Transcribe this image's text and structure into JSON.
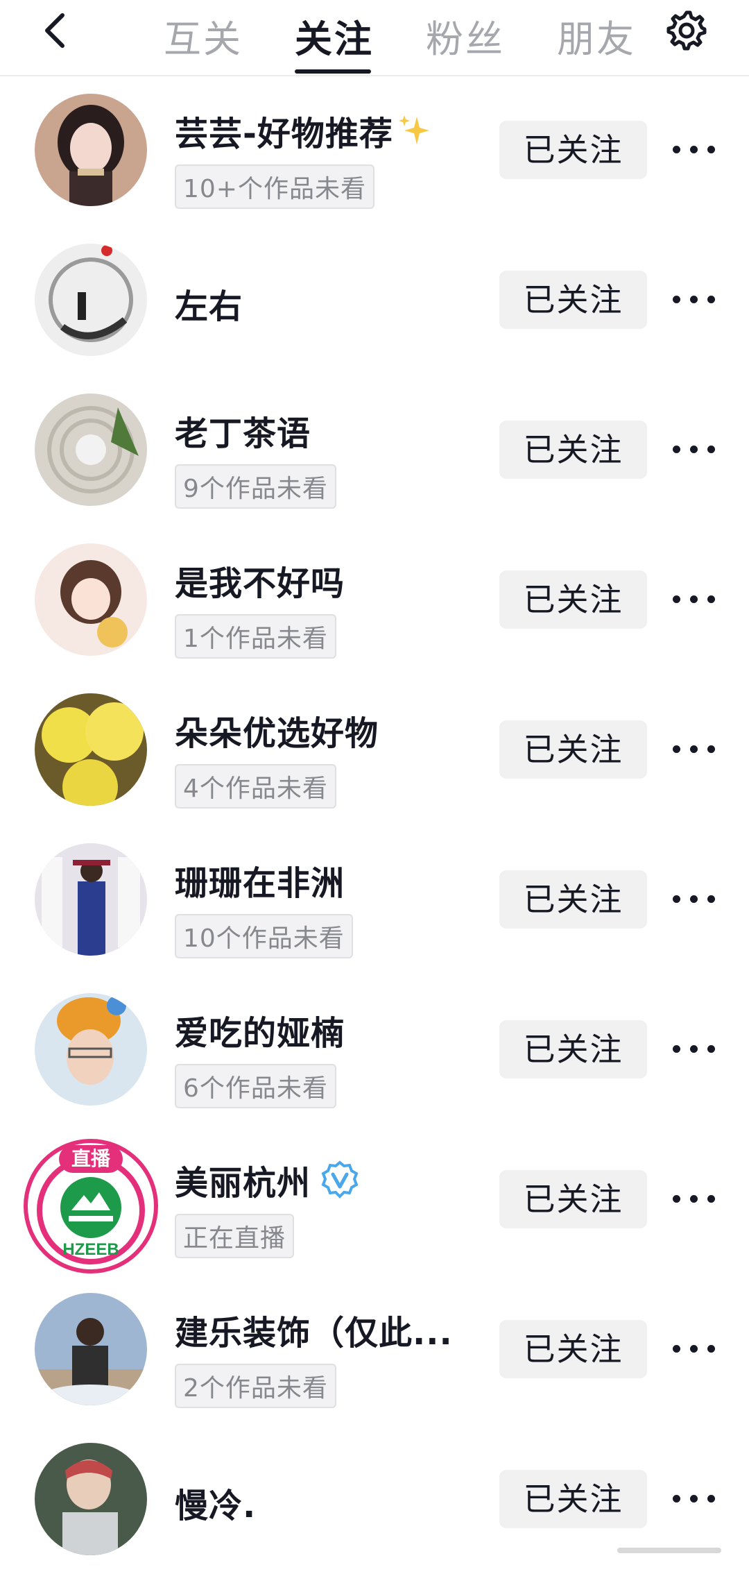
{
  "nav": {
    "back_icon": "chevron-left-icon",
    "tabs": [
      {
        "label": "互关",
        "active": false
      },
      {
        "label": "关注",
        "active": true
      },
      {
        "label": "粉丝",
        "active": false
      },
      {
        "label": "朋友",
        "active": false
      }
    ],
    "settings_icon": "gear-icon"
  },
  "colors": {
    "text_primary": "#161823",
    "text_secondary": "#86888e",
    "tab_inactive": "#a5a7ad",
    "button_bg": "#f1f1f2",
    "verified_blue": "#4aa8ea",
    "live_badge_pink": "#e4307a"
  },
  "follow_list": [
    {
      "name": "芸芸-好物推荐",
      "badge": "10+个作品未看",
      "button": "已关注",
      "sparkle": true
    },
    {
      "name": "左右",
      "badge": "",
      "button": "已关注"
    },
    {
      "name": "老丁茶语",
      "badge": "9个作品未看",
      "button": "已关注"
    },
    {
      "name": "是我不好吗",
      "badge": "1个作品未看",
      "button": "已关注"
    },
    {
      "name": "朵朵优选好物",
      "badge": "4个作品未看",
      "button": "已关注"
    },
    {
      "name": "珊珊在非洲",
      "badge": "10个作品未看",
      "button": "已关注"
    },
    {
      "name": "爱吃的娅楠",
      "badge": "6个作品未看",
      "button": "已关注"
    },
    {
      "name": "美丽杭州",
      "badge": "正在直播",
      "button": "已关注",
      "verified": true,
      "live_label": "直播",
      "logo_text": "HZEEB"
    },
    {
      "name": "建乐装饰（仅此...",
      "badge": "2个作品未看",
      "button": "已关注"
    },
    {
      "name": "慢冷.",
      "badge": "",
      "button": "已关注"
    }
  ]
}
